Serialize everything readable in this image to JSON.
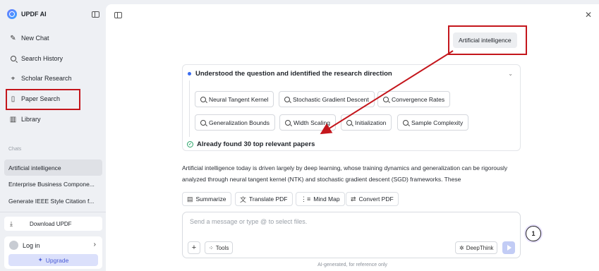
{
  "sidebar": {
    "brand": "UPDF AI",
    "nav": [
      {
        "label": "New Chat",
        "icon": "edit-icon"
      },
      {
        "label": "Search History",
        "icon": "search-icon"
      },
      {
        "label": "Scholar Research",
        "icon": "telescope-icon"
      },
      {
        "label": "Paper Search",
        "icon": "paper-search-icon"
      },
      {
        "label": "Library",
        "icon": "library-icon"
      }
    ],
    "section_label": "Chats",
    "chats": [
      "Artificial intelligence",
      "Enterprise Business Compone...",
      "Generate IEEE Style Citation f..."
    ],
    "download_label": "Download UPDF",
    "login_label": "Log in",
    "upgrade_label": "Upgrade"
  },
  "main": {
    "user_message": "Artificial intelligence",
    "card": {
      "title": "Understood the question and identified the research direction",
      "chips": [
        "Neural Tangent Kernel",
        "Stochastic Gradient Descent",
        "Convergence Rates",
        "Generalization Bounds",
        "Width Scaling",
        "Initialization",
        "Sample Complexity"
      ],
      "found_text": "Already found 30 top relevant papers"
    },
    "answer_text": "Artificial intelligence today is driven largely by deep learning, whose training dynamics and generalization can be rigorously analyzed through neural tangent kernel (NTK) and stochastic gradient descent (SGD) frameworks. These",
    "actions": [
      "Summarize",
      "Translate PDF",
      "Mind Map",
      "Convert PDF"
    ],
    "composer": {
      "placeholder": "Send a message or type @ to select files.",
      "tools_label": "Tools",
      "deepthink_label": "DeepThink"
    },
    "step_badge": "1",
    "footer_note": "AI-generated, for reference only"
  },
  "colors": {
    "accent": "#3a6cf0",
    "annotation_red": "#c4161c",
    "upgrade_text": "#4a5bd6"
  }
}
